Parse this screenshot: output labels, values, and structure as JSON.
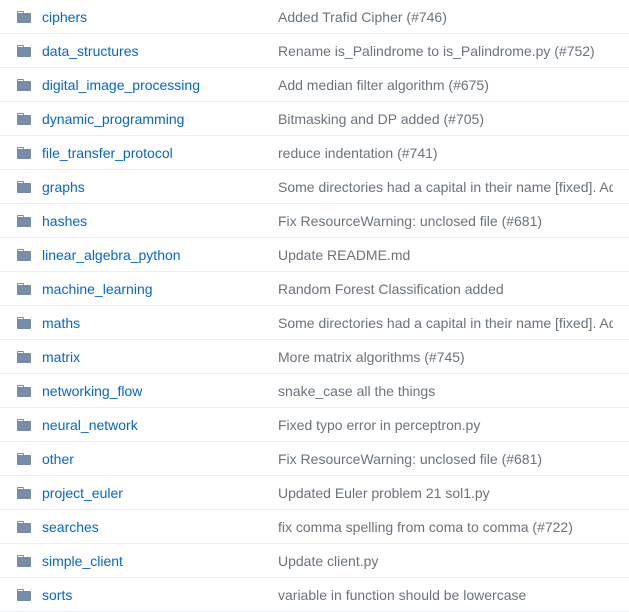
{
  "files": [
    {
      "name": "ciphers",
      "commit": "Added Trafid Cipher (#746)"
    },
    {
      "name": "data_structures",
      "commit": "Rename is_Palindrome to is_Palindrome.py (#752)"
    },
    {
      "name": "digital_image_processing",
      "commit": "Add median filter algorithm (#675)"
    },
    {
      "name": "dynamic_programming",
      "commit": "Bitmasking and DP added (#705)"
    },
    {
      "name": "file_transfer_protocol",
      "commit": "reduce indentation (#741)"
    },
    {
      "name": "graphs",
      "commit": "Some directories had a capital in their name [fixed]. Adde"
    },
    {
      "name": "hashes",
      "commit": "Fix ResourceWarning: unclosed file (#681)"
    },
    {
      "name": "linear_algebra_python",
      "commit": "Update README.md"
    },
    {
      "name": "machine_learning",
      "commit": "Random Forest Classification added"
    },
    {
      "name": "maths",
      "commit": "Some directories had a capital in their name [fixed]. Adde"
    },
    {
      "name": "matrix",
      "commit": "More matrix algorithms (#745)"
    },
    {
      "name": "networking_flow",
      "commit": "snake_case all the things"
    },
    {
      "name": "neural_network",
      "commit": "Fixed typo error in perceptron.py"
    },
    {
      "name": "other",
      "commit": "Fix ResourceWarning: unclosed file (#681)"
    },
    {
      "name": "project_euler",
      "commit": "Updated Euler problem 21 sol1.py"
    },
    {
      "name": "searches",
      "commit": "fix comma spelling from coma to comma (#722)"
    },
    {
      "name": "simple_client",
      "commit": "Update client.py"
    },
    {
      "name": "sorts",
      "commit": "variable in function should be lowercase"
    }
  ]
}
